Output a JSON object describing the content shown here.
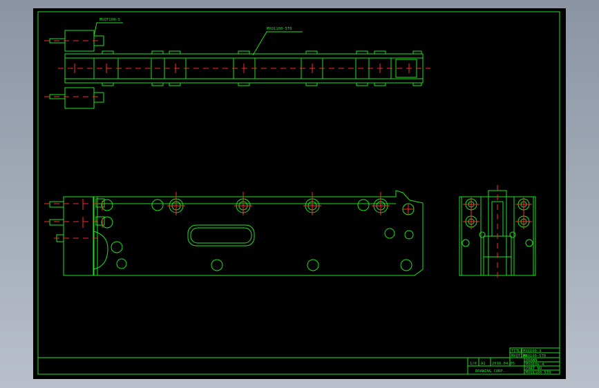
{
  "drawing": {
    "background": "#000000",
    "line_color": "#1de31d",
    "centerline_color": "#ff2a2a",
    "callouts": {
      "cylinder_top": "MSQT100-S",
      "rail": "MXQ1100-5T0"
    },
    "title_block": {
      "row1": [
        "TITLE",
        "MXQ100-3"
      ],
      "row2": [
        "MXQT100",
        "MXQ100-5T0"
      ],
      "scale": "1/0",
      "sheet": "A1",
      "date": "2016.04.05",
      "part": "MXQ10e-4",
      "drawn": "DRAWN",
      "partno": "PART NO",
      "company": "DRAWING CORP.",
      "code": "MXQ1100-5T0"
    }
  }
}
